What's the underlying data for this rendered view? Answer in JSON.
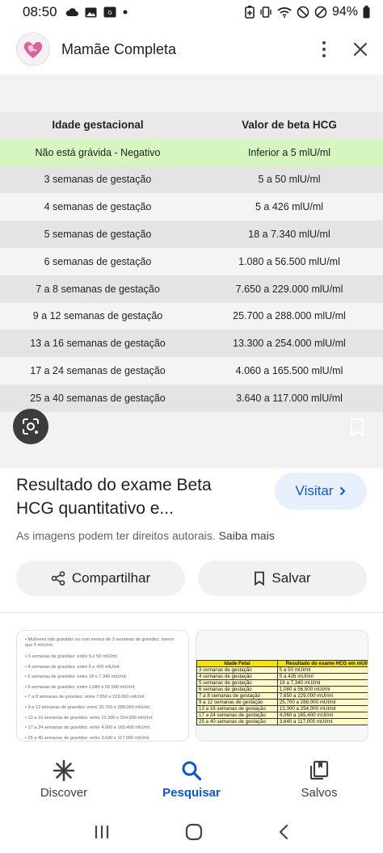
{
  "status": {
    "time": "08:50",
    "battery": "94%"
  },
  "header": {
    "title": "Mamãe Completa",
    "logo_icon": "baby-heart-logo",
    "menu_icon": "more-vert-icon",
    "close_icon": "close-icon"
  },
  "image_table": {
    "headers": [
      "Idade gestacional",
      "Valor de beta HCG"
    ],
    "rows": [
      [
        "Não está grávida - Negativo",
        "Inferior a 5 mlU/ml"
      ],
      [
        "3 semanas de gestação",
        "5 a 50 mlU/ml"
      ],
      [
        "4 semanas de gestação",
        "5 a 426 mlU/ml"
      ],
      [
        "5 semanas de gestação",
        "18 a 7.340 mlU/ml"
      ],
      [
        "6 semanas de gestação",
        "1.080 a 56.500 mlU/ml"
      ],
      [
        "7 a 8 semanas de gestação",
        "7.650 a 229.000 mlU/ml"
      ],
      [
        "9 a 12 semanas de gestação",
        "25.700 a 288.000 mlU/ml"
      ],
      [
        "13 a 16 semanas de gestação",
        "13.300 a 254.000 mlU/ml"
      ],
      [
        "17 a 24 semanas de gestação",
        "4.060 a 165.500 mlU/ml"
      ],
      [
        "25 a 40 semanas de gestação",
        "3.640 a 117.000 mlU/ml"
      ]
    ],
    "highlight_color": "#d6f6c0"
  },
  "result": {
    "title_line1": "Resultado do exame Beta",
    "title_line2": "HCG quantitativo e...",
    "visit_label": "Visitar",
    "rights_text": "As imagens podem ter direitos autorais.",
    "rights_link": "Saiba mais",
    "share_label": "Compartilhar",
    "save_label": "Salvar"
  },
  "related": {
    "thumb1_lines": [
      "• Mulheres não grávidas ou com menos de 3 semanas de gravidez: menor que 5 mlU/ml;",
      "• 3 semanas de gravidez: entre 5 e 50 mlU/ml;",
      "• 4 semanas de gravidez: entre 5 e 426 mlU/ml;",
      "• 5 semanas de gravidez: entre 18 e 7.340 mlU/ml;",
      "• 6 semanas de gravidez: entre 1.080 e 56.500 mlU/ml;",
      "• 7 a 8 semanas de gravidez: entre 7.650 e 229.000 mlU/ml;",
      "• 9 a 12 semanas de gravidez: entre 25.700 e 288.000 mlU/ml;",
      "• 13 a 16 semanas de gravidez: entre 13.300 e 254.000 mlU/ml;",
      "• 17 a 24 semanas de gravidez: entre 4.060 e 165.400 mlU/ml;",
      "• 25 a 40 semanas de gravidez: entre 3.640 e 117.000 mlU/ml."
    ],
    "thumb2_headers": [
      "Idade Fetal",
      "Resultado do exame HCG em mUI/ml"
    ],
    "thumb2_rows": [
      [
        "3 semanas de gestação",
        "5 a 50 mUI/ml"
      ],
      [
        "4 semanas de gestação",
        "5 a 426 mUI/ml"
      ],
      [
        "5 semanas de gestação",
        "18 a 7,340 mUI/ml"
      ],
      [
        "6 semanas de gestação",
        "1,080 a 56,500 mUI/ml"
      ],
      [
        "7 a 8 semanas de gestação",
        "7,650 a 229,000 mUI/ml"
      ],
      [
        "9 a 12 semanas de gestação",
        "25,700 a 288,000 mUI/ml"
      ],
      [
        "13 a 16 semanas de gestação",
        "13,300 a 254,000 mUI/ml"
      ],
      [
        "17 a 24 semanas de gestação",
        "4,060 a 165,400 mUI/ml"
      ],
      [
        "25 a 40 semanas de gestação",
        "3,640 a 117,000 mUI/ml"
      ]
    ]
  },
  "bottom_nav": {
    "items": [
      {
        "label": "Discover",
        "icon": "asterisk-icon"
      },
      {
        "label": "Pesquisar",
        "icon": "search-icon"
      },
      {
        "label": "Salvos",
        "icon": "collections-bookmark-icon"
      }
    ],
    "active_color": "#0b57d0"
  }
}
